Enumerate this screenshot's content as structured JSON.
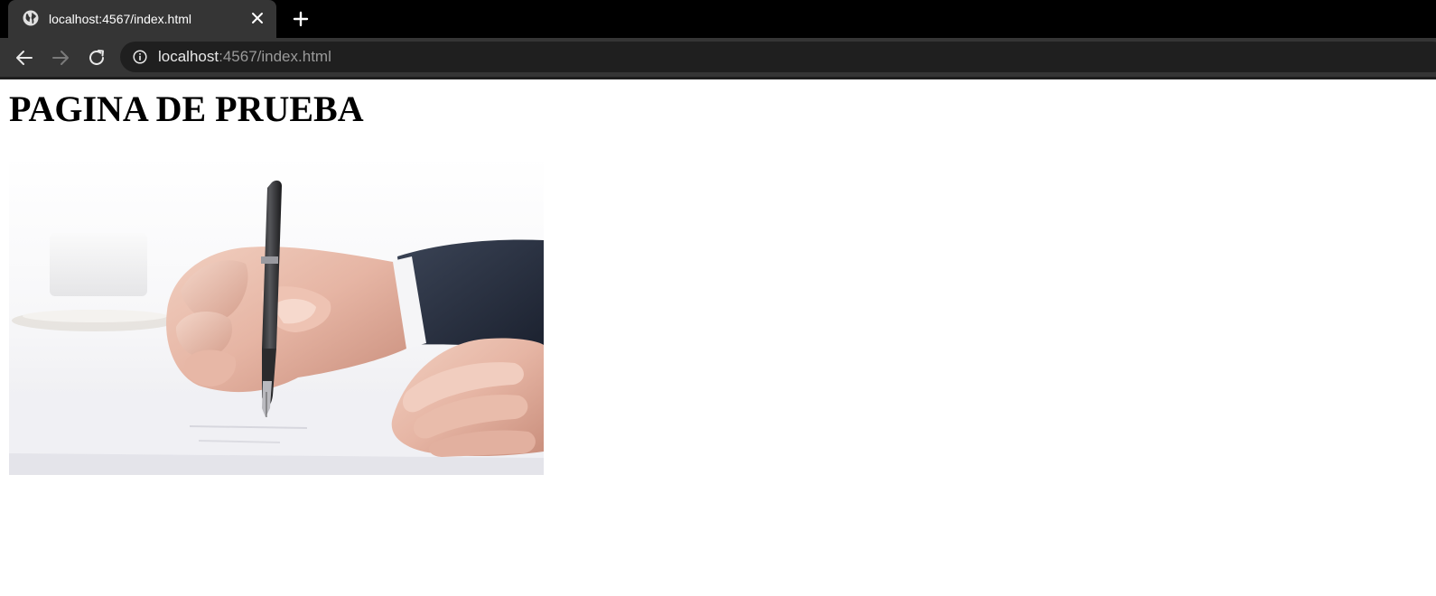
{
  "browser": {
    "tab": {
      "title": "localhost:4567/index.html",
      "favicon": "globe-icon",
      "close_icon": "close-icon"
    },
    "new_tab_icon": "plus-icon",
    "toolbar": {
      "back_icon": "arrow-left-icon",
      "forward_icon": "arrow-right-icon",
      "reload_icon": "reload-icon",
      "info_icon": "info-icon"
    },
    "omnibox": {
      "host": "localhost",
      "rest": ":4567/index.html"
    },
    "colors": {
      "frame": "#000000",
      "toolbar": "#353535",
      "omnibox": "#1f1f1f"
    }
  },
  "page": {
    "title": "PAGINA DE PRUEBA",
    "image": {
      "subject": "hand-writing-with-fountain-pen-photo"
    }
  }
}
